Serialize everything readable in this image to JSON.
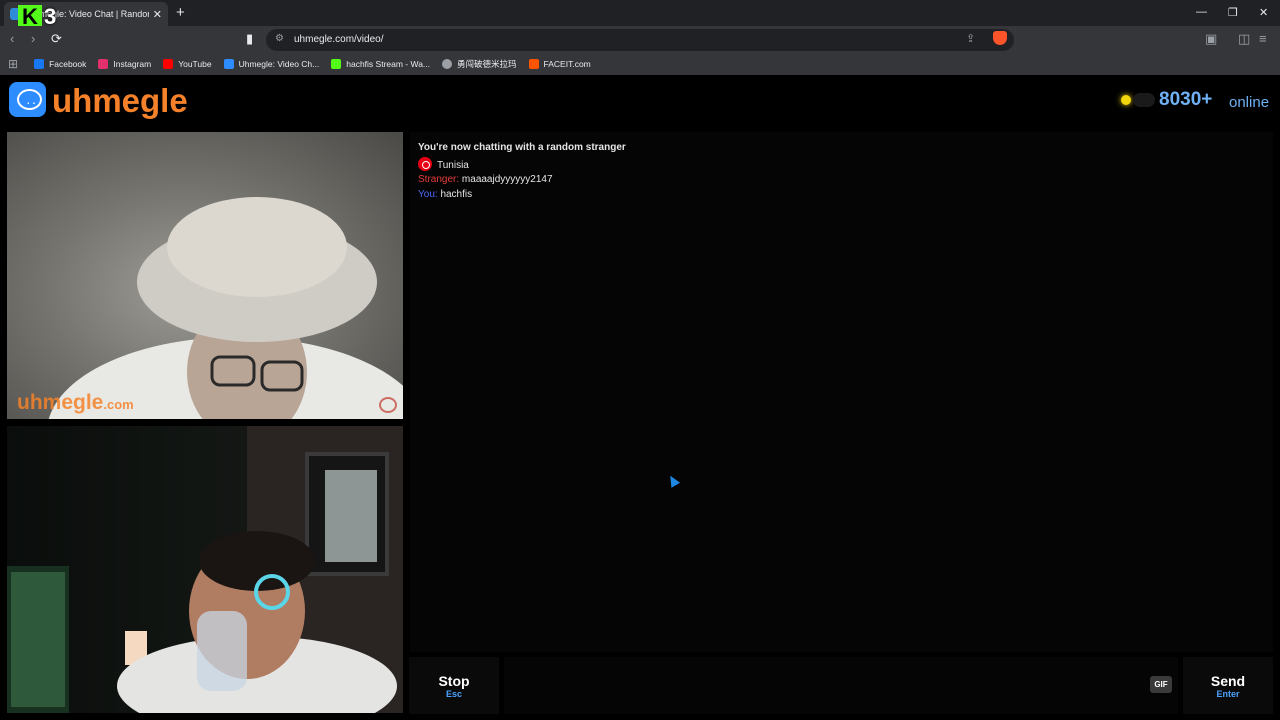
{
  "browser": {
    "tab_title": "Uhmegle: Video Chat | Random",
    "new_tab": "+",
    "url": "uhmegle.com/video/",
    "overlay_logo_letter": "K",
    "overlay_logo_number": "3",
    "bookmarks": [
      {
        "label": "Facebook",
        "color": "#1877f2"
      },
      {
        "label": "Instagram",
        "color": "#e1306c"
      },
      {
        "label": "YouTube",
        "color": "#ff0000"
      },
      {
        "label": "Uhmegle: Video Ch...",
        "color": "#2d8cff"
      },
      {
        "label": "hachfis Stream - Wa...",
        "color": "#53fc18"
      },
      {
        "label": "勇闯破德米拉玛",
        "color": "#9aa0a6"
      },
      {
        "label": "FACEIT.com",
        "color": "#ff5500"
      }
    ]
  },
  "site": {
    "logo": "uhmegle",
    "online_count": "8030+",
    "online_label": "online"
  },
  "video": {
    "watermark": "uhmegle",
    "watermark_suffix": ".com"
  },
  "chat": {
    "status": "You're now chatting with a random stranger",
    "country": "Tunisia",
    "messages": [
      {
        "sender": "Stranger:",
        "text": "maaaajdyyyyyy2147"
      },
      {
        "sender": "You:",
        "text": "hachfis"
      }
    ]
  },
  "composer": {
    "stop_label": "Stop",
    "stop_hint": "Esc",
    "gif_label": "GIF",
    "send_label": "Send",
    "send_hint": "Enter",
    "input_value": ""
  }
}
